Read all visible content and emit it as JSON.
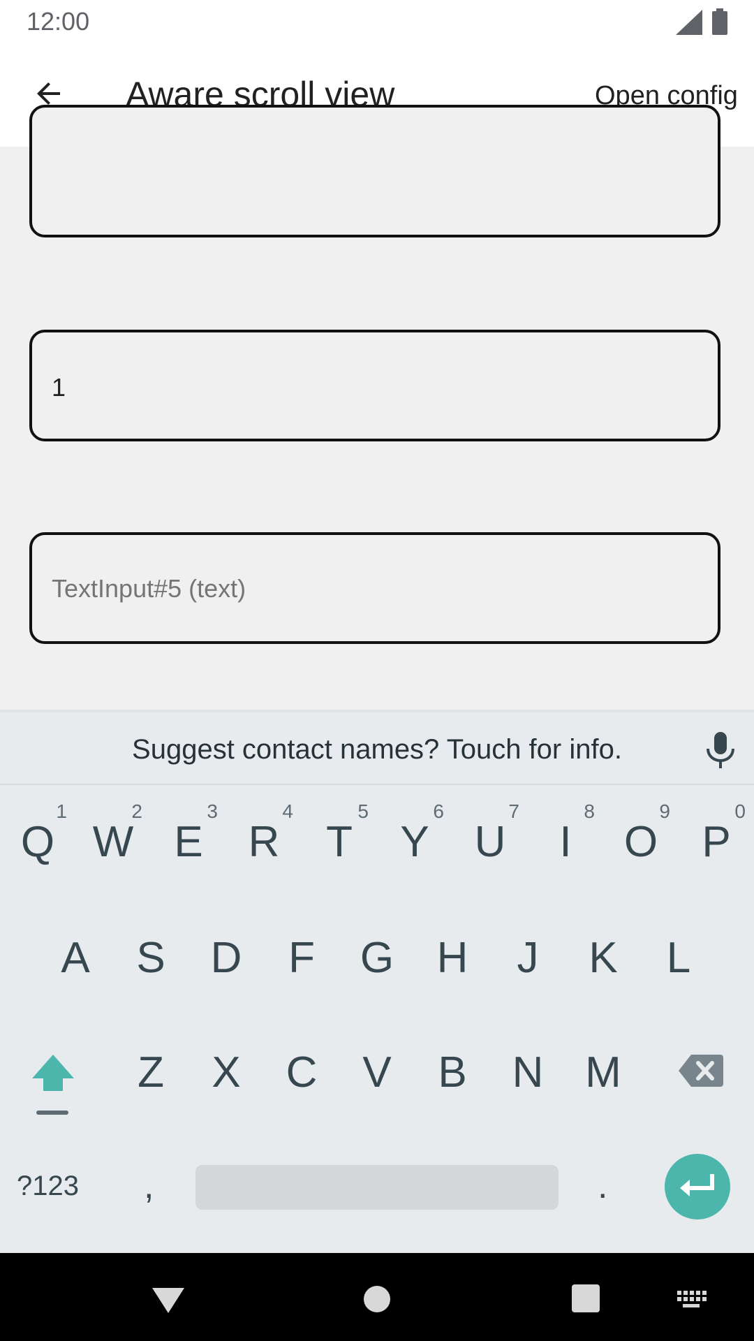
{
  "status_bar": {
    "time": "12:00",
    "icons": [
      "signal-icon",
      "battery-icon"
    ]
  },
  "app_bar": {
    "title": "Aware scroll view",
    "action_label": "Open config",
    "back_icon": "arrow-back-icon"
  },
  "content": {
    "input4": {
      "value": "1"
    },
    "input5": {
      "placeholder": "TextInput#5 (text)"
    }
  },
  "keyboard": {
    "suggestion": "Suggest contact names? Touch for info.",
    "row1": [
      {
        "key": "Q",
        "num": "1"
      },
      {
        "key": "W",
        "num": "2"
      },
      {
        "key": "E",
        "num": "3"
      },
      {
        "key": "R",
        "num": "4"
      },
      {
        "key": "T",
        "num": "5"
      },
      {
        "key": "Y",
        "num": "6"
      },
      {
        "key": "U",
        "num": "7"
      },
      {
        "key": "I",
        "num": "8"
      },
      {
        "key": "O",
        "num": "9"
      },
      {
        "key": "P",
        "num": "0"
      }
    ],
    "row2": [
      "A",
      "S",
      "D",
      "F",
      "G",
      "H",
      "J",
      "K",
      "L"
    ],
    "row3": [
      "Z",
      "X",
      "C",
      "V",
      "B",
      "N",
      "M"
    ],
    "row4": {
      "symbols": "?123",
      "comma": ",",
      "period": "."
    },
    "accent": "#4db6ac"
  },
  "nav_bar": {
    "icons": [
      "nav-back-icon",
      "nav-home-icon",
      "nav-recents-icon",
      "nav-keyboard-icon"
    ]
  }
}
